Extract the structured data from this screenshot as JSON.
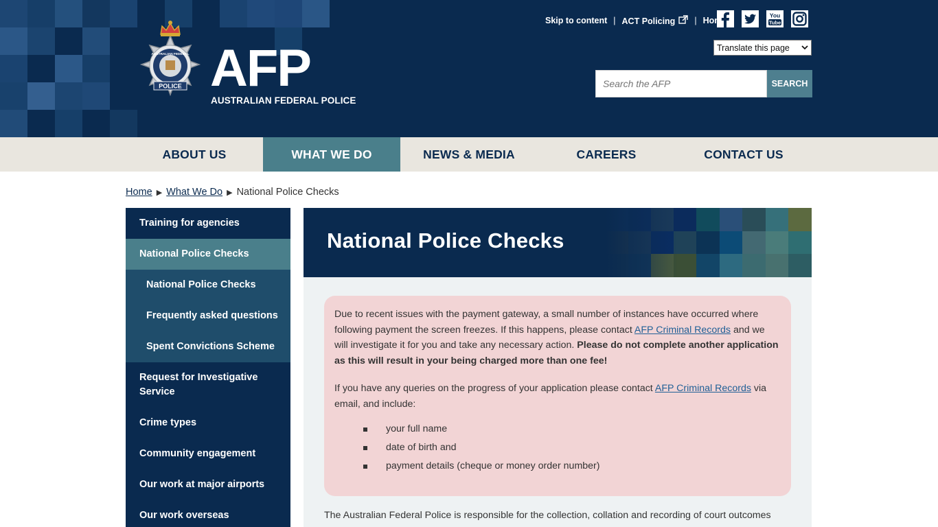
{
  "header": {
    "logo": {
      "badge_ring_text": "AUSTRALIAN FEDERAL",
      "badge_police_text": "POLICE",
      "acronym": "AFP",
      "full_name": "AUSTRALIAN FEDERAL POLICE"
    },
    "top_links": [
      {
        "label": "Skip to content"
      },
      {
        "label": "ACT Policing",
        "external": true
      },
      {
        "label": "Home"
      }
    ],
    "separator": "|",
    "social_icons": [
      "facebook-icon",
      "twitter-icon",
      "youtube-icon",
      "instagram-icon"
    ],
    "youtube_text": {
      "line1": "You",
      "line2": "Tube"
    },
    "translate": {
      "selected": "Translate this page"
    },
    "search": {
      "placeholder": "Search the AFP",
      "button_label": "SEARCH"
    }
  },
  "nav": {
    "items": [
      {
        "label": "ABOUT US",
        "active": false
      },
      {
        "label": "WHAT WE DO",
        "active": true
      },
      {
        "label": "NEWS & MEDIA",
        "active": false
      },
      {
        "label": "CAREERS",
        "active": false
      },
      {
        "label": "CONTACT US",
        "active": false
      }
    ]
  },
  "breadcrumb": {
    "items": [
      {
        "label": "Home",
        "link": true
      },
      {
        "label": "What We Do",
        "link": true
      },
      {
        "label": "National Police Checks",
        "link": false
      }
    ],
    "arrow": "▶"
  },
  "sidebar": {
    "items": [
      {
        "label": "Training for agencies"
      },
      {
        "label": "National Police Checks",
        "active": true
      },
      {
        "label": "National Police Checks",
        "sub": true
      },
      {
        "label": "Frequently asked questions",
        "sub": true
      },
      {
        "label": "Spent Convictions Scheme",
        "sub": true
      },
      {
        "label": "Request for Investigative Service"
      },
      {
        "label": "Crime types"
      },
      {
        "label": "Community engagement"
      },
      {
        "label": "Our work at major airports"
      },
      {
        "label": "Our work overseas"
      }
    ]
  },
  "main": {
    "title": "National Police Checks",
    "alert": {
      "p1_part1": "Due to recent issues with the payment gateway, a small number of instances have occurred where following payment the screen freezes. If this happens, please contact ",
      "p1_link": "AFP Criminal Records",
      "p1_part2": " and we will investigate it for you and take any necessary action. ",
      "p1_bold": "Please do not complete another application as this will result in your being charged more than one fee!",
      "p2_part1": "If you have any queries on the progress of your application please contact ",
      "p2_link": "AFP Criminal Records",
      "p2_part2": " via email, and include:",
      "list": [
        "your full name",
        "date of birth and",
        "payment details (cheque or money order number)"
      ]
    },
    "body_text": "The Australian Federal Police is responsible for the collection, collation and recording of court outcomes"
  },
  "colors": {
    "navy": "#0a2a4f",
    "teal": "#4a7f8b",
    "nav_bg": "#e9e6df",
    "alert_bg": "#f2d4d5",
    "link": "#1f5f96"
  }
}
